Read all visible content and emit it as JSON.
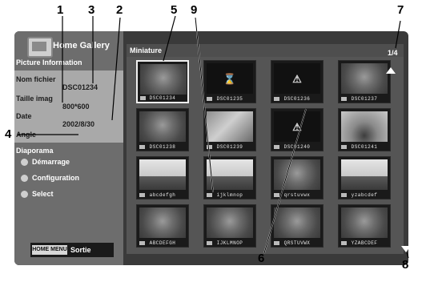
{
  "header": {
    "title": "Home Gallery",
    "miniature": "Miniature",
    "page": "1/4"
  },
  "sidebar": {
    "info_header": "Picture Information",
    "fields": [
      {
        "label": "Nom fichier",
        "value": "DSC01234"
      },
      {
        "label": "Taille imag",
        "value": "800*600"
      },
      {
        "label": "Date",
        "value": "2002/8/30"
      },
      {
        "label": "Angle",
        "value": ""
      }
    ],
    "slideshow_title": "Diaporama",
    "menu": [
      "Démarrage",
      "Configuration",
      "Select"
    ],
    "home_menu": "HOME MENU",
    "exit": "Sortie"
  },
  "thumbnails": [
    {
      "caption": "DSC01234",
      "type": "tree",
      "selected": true
    },
    {
      "caption": "DSC01235",
      "type": "hourglass"
    },
    {
      "caption": "DSC01236",
      "type": "warning"
    },
    {
      "caption": "DSC01237",
      "type": "tree"
    },
    {
      "caption": "DSC01238",
      "type": "tree"
    },
    {
      "caption": "DSC01239",
      "type": "road"
    },
    {
      "caption": "DSC01240",
      "type": "warning"
    },
    {
      "caption": "DSC01241",
      "type": "bare"
    },
    {
      "caption": "abcdefgh",
      "type": "sky"
    },
    {
      "caption": "ijklmnop",
      "type": "sky"
    },
    {
      "caption": "qrstuvwx",
      "type": "tree"
    },
    {
      "caption": "yzabcdef",
      "type": "sky"
    },
    {
      "caption": "ABCDEFGH",
      "type": "tree"
    },
    {
      "caption": "IJKLMNOP",
      "type": "tree"
    },
    {
      "caption": "QRSTUVWX",
      "type": "tree"
    },
    {
      "caption": "YZABCDEF",
      "type": "tree"
    }
  ],
  "callouts": [
    "1",
    "2",
    "3",
    "4",
    "5",
    "6",
    "7",
    "8",
    "9"
  ],
  "icons": {
    "hourglass": "⌛",
    "warning": "⚠"
  }
}
